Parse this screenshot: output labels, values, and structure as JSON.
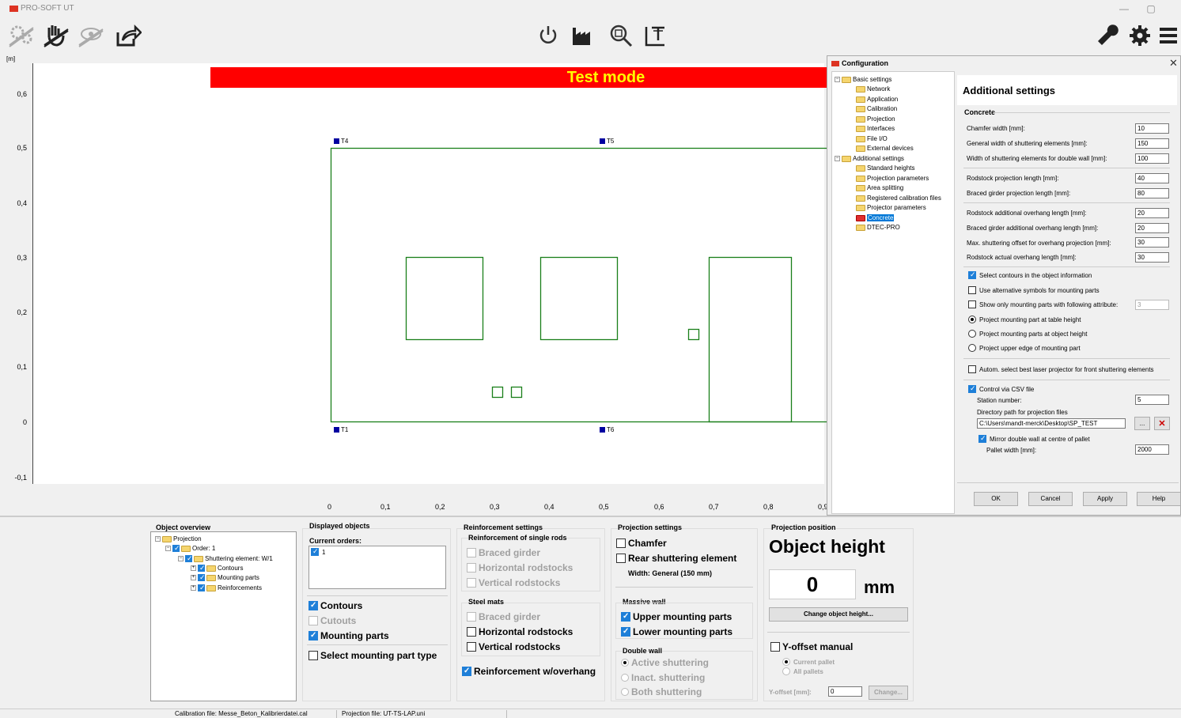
{
  "app": {
    "title": "PRO-SOFT UT"
  },
  "window_buttons": {
    "minimize": "—",
    "restore": "▢",
    "close": "✕"
  },
  "canvas": {
    "banner": "Test mode",
    "y_unit": "[m]",
    "y_ticks": [
      "0,6",
      "0,5",
      "0,4",
      "0,3",
      "0,2",
      "0,1",
      "0",
      "-0,1"
    ],
    "x_ticks": [
      "0",
      "0,1",
      "0,2",
      "0,3",
      "0,4",
      "0,5",
      "0,6",
      "0,7",
      "0,8",
      "0,9"
    ],
    "markers": [
      "T4",
      "T5",
      "T1",
      "T6"
    ]
  },
  "config": {
    "title": "Configuration",
    "close": "✕",
    "tree": {
      "basic": "Basic settings",
      "network": "Network",
      "application": "Application",
      "calibration": "Calibration",
      "projection": "Projection",
      "interfaces": "Interfaces",
      "file_io": "File I/O",
      "external": "External devices",
      "additional": "Additional settings",
      "standard_heights": "Standard heights",
      "projection_params": "Projection parameters",
      "area_splitting": "Area splitting",
      "registered_cal": "Registered calibration files",
      "projector_params": "Projector parameters",
      "concrete": "Concrete",
      "dtec": "DTEC-PRO"
    },
    "heading": "Additional settings",
    "section": "Concrete",
    "fields": [
      {
        "label": "Chamfer width [mm]:",
        "value": "10"
      },
      {
        "label": "General width of shuttering elements [mm]:",
        "value": "150"
      },
      {
        "label": "Width of shuttering elements for double wall [mm]:",
        "value": "100"
      },
      {
        "label": "Rodstock projection length [mm]:",
        "value": "40"
      },
      {
        "label": "Braced girder projection length [mm]:",
        "value": "80"
      },
      {
        "label": "Rodstock additional overhang length [mm]:",
        "value": "20"
      },
      {
        "label": "Braced girder additional overhang length [mm]:",
        "value": "20"
      },
      {
        "label": "Max. shuttering offset for overhang projection [mm]:",
        "value": "30"
      },
      {
        "label": "Rodstock actual overhang length [mm]:",
        "value": "30"
      }
    ],
    "select_contours": "Select contours in the object information",
    "alt_symbols": "Use alternative symbols for mounting parts",
    "show_only": "Show only mounting parts with following attribute:",
    "show_only_value": "3",
    "radio_table": "Project mounting part at table height",
    "radio_object": "Project mounting parts at object height",
    "radio_upper": "Project upper edge of mounting part",
    "autom": "Autom. select best laser projector for front shuttering elements",
    "csv": "Control via CSV file",
    "station_label": "Station number:",
    "station_value": "5",
    "dir_label": "Directory path for projection files",
    "dir_value": "C:\\Users\\mandt-merck\\Desktop\\SP_TEST",
    "browse": "...",
    "delete": "✕",
    "mirror": "Mirror double wall at centre of pallet",
    "pallet_label": "Pallet width [mm]:",
    "pallet_value": "2000",
    "buttons": {
      "ok": "OK",
      "cancel": "Cancel",
      "apply": "Apply",
      "help": "Help"
    }
  },
  "bottom": {
    "overview": {
      "title": "Object overview",
      "projection": "Projection",
      "order": "Order: 1",
      "element": "Shuttering element: W/1",
      "contours": "Contours",
      "mounting": "Mounting parts",
      "reinforcements": "Reinforcements"
    },
    "displayed": {
      "title": "Displayed objects",
      "current_orders": "Current orders:",
      "order_item": "1",
      "contours": "Contours",
      "cutouts": "Cutouts",
      "mounting": "Mounting parts",
      "select_type": "Select mounting part type"
    },
    "reinf": {
      "title": "Reinforcement settings",
      "single_rods": "Reinforcement of single rods",
      "braced1": "Braced girder",
      "horiz1": "Horizontal rodstocks",
      "vert1": "Vertical rodstocks",
      "steel_mats": "Steel mats",
      "braced2": "Braced girder",
      "horiz2": "Horizontal rodstocks",
      "vert2": "Vertical rodstocks",
      "overhang": "Reinforcement w/overhang"
    },
    "projset": {
      "title": "Projection settings",
      "chamfer": "Chamfer",
      "rear": "Rear shuttering element",
      "width": "Width: General (150 mm)",
      "massive": "Massive wall",
      "upper": "Upper mounting parts",
      "lower": "Lower mounting parts",
      "double": "Double wall",
      "active": "Active shuttering",
      "inact": "Inact. shuttering",
      "both": "Both shuttering"
    },
    "projpos": {
      "title": "Projection position",
      "heading": "Object height",
      "value": "0",
      "unit": "mm",
      "change_height": "Change object height...",
      "yoffset": "Y-offset manual",
      "current_pallet": "Current pallet",
      "all_pallets": "All pallets",
      "yoffset_label": "Y-offset [mm]:",
      "yoffset_value": "0",
      "change": "Change..."
    }
  },
  "status": {
    "calibration": "Calibration file: Messe_Beton_Kalibrierdatei.cal",
    "projection": "Projection file: UT-TS-LAP.uni"
  },
  "colors": {
    "banner_bg": "#ff0000",
    "banner_fg": "#ffff00",
    "contour": "#1a7f1a",
    "marker": "#0000a0",
    "accent": "#0078d7"
  }
}
